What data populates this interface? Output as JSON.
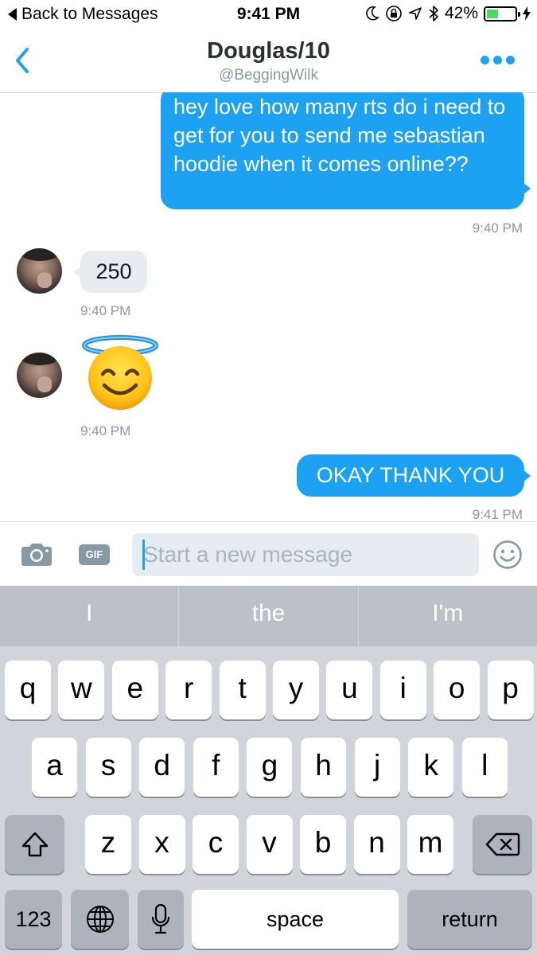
{
  "status_bar": {
    "back_label": "Back to Messages",
    "time": "9:41 PM",
    "battery_text": "42%",
    "battery_level": 0.42,
    "icons": [
      "moon-icon",
      "rotation-lock-icon",
      "location-arrow-icon",
      "bluetooth-icon",
      "battery-icon",
      "charging-bolt-icon"
    ]
  },
  "header": {
    "title": "Douglas/10",
    "handle": "@BeggingWilk",
    "icons": [
      "chevron-left-icon",
      "more-dots-icon"
    ]
  },
  "messages": [
    {
      "direction": "out",
      "text": "hey love how many rts do i need to get for you to send me sebastian hoodie when it comes online??",
      "time": "9:40 PM"
    },
    {
      "direction": "in",
      "text": "250",
      "time": "9:40 PM"
    },
    {
      "direction": "in",
      "emoji": "smiling-face-with-halo",
      "time": "9:40 PM"
    },
    {
      "direction": "out",
      "text": "OKAY THANK YOU",
      "time": "9:41 PM"
    }
  ],
  "composer": {
    "placeholder": "Start a new message",
    "gif_label": "GIF",
    "icons": [
      "camera-icon",
      "gif-icon",
      "smiley-icon"
    ]
  },
  "keyboard": {
    "suggestions": [
      "I",
      "the",
      "I'm"
    ],
    "row1": [
      "q",
      "w",
      "e",
      "r",
      "t",
      "y",
      "u",
      "i",
      "o",
      "p"
    ],
    "row2": [
      "a",
      "s",
      "d",
      "f",
      "g",
      "h",
      "j",
      "k",
      "l"
    ],
    "row3": [
      "z",
      "x",
      "c",
      "v",
      "b",
      "n",
      "m"
    ],
    "numbers_label": "123",
    "space_label": "space",
    "return_label": "return",
    "icons": [
      "shift-icon",
      "backspace-icon",
      "globe-icon",
      "microphone-icon"
    ]
  },
  "colors": {
    "accent": "#1da1f2",
    "incoming_bubble": "#e6ecf0",
    "keyboard_bg": "#d1d5db",
    "battery_green": "#4cd964"
  }
}
